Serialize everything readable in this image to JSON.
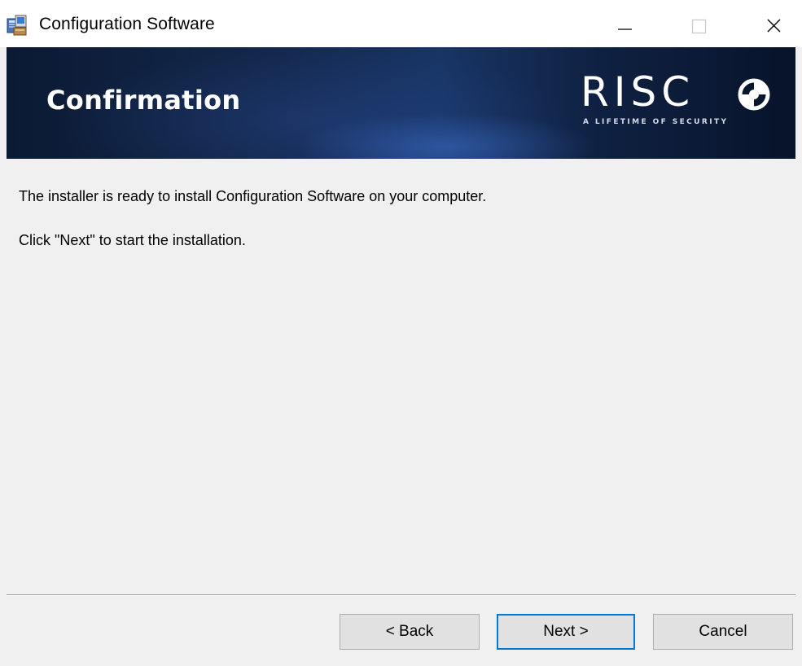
{
  "window": {
    "title": "Configuration Software",
    "app_icon": "installer-computer-icon",
    "controls": {
      "minimize_icon": "minimize-icon",
      "maximize_icon": "maximize-icon",
      "close_icon": "close-icon"
    }
  },
  "banner": {
    "title": "Confirmation",
    "brand_name": "RISC",
    "brand_mark_icon": "risco-swirl-icon",
    "tagline": "A LIFETIME OF SECURITY"
  },
  "body": {
    "line1": "The installer is ready to install Configuration Software on your computer.",
    "line2": "Click \"Next\" to start the installation."
  },
  "buttons": {
    "back": "< Back",
    "next": "Next >",
    "cancel": "Cancel"
  },
  "colors": {
    "focus_accent": "#0078d7",
    "banner_dark": "#0b1a33",
    "button_face": "#e1e1e1"
  }
}
